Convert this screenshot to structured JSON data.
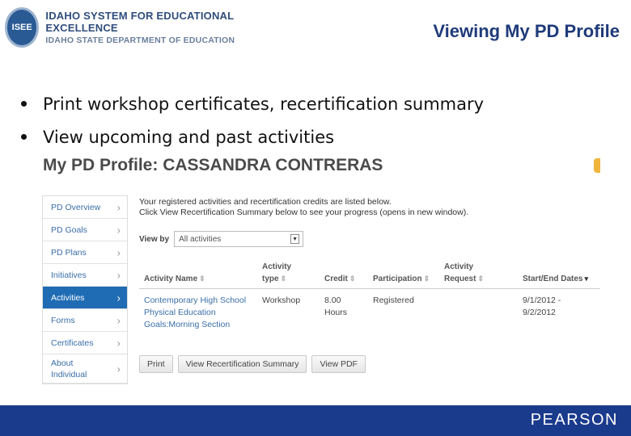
{
  "header": {
    "logo_seal": "ISEE",
    "logo_line1": "IDAHO SYSTEM FOR EDUCATIONAL EXCELLENCE",
    "logo_line2": "IDAHO STATE DEPARTMENT OF EDUCATION",
    "slide_title": "Viewing My PD Profile"
  },
  "bullets": [
    "Print workshop certificates, recertification summary",
    "View upcoming and past activities"
  ],
  "profile": {
    "title_prefix": "My PD Profile:",
    "name": "CASSANDRA CONTRERAS"
  },
  "sidebar": {
    "items": [
      {
        "label": "PD Overview"
      },
      {
        "label": "PD Goals"
      },
      {
        "label": "PD Plans"
      },
      {
        "label": "Initiatives"
      },
      {
        "label": "Activities"
      },
      {
        "label": "Forms"
      },
      {
        "label": "Certificates"
      },
      {
        "label": "About Individual"
      }
    ],
    "active": "Activities",
    "chevron": "›"
  },
  "content": {
    "intro_line1": "Your registered activities and recertification credits are listed below.",
    "intro_line2": "Click View Recertification Summary below to see your progress (opens in new window).",
    "view_by_label": "View by",
    "view_by_value": "All activities",
    "columns": {
      "activity_name": "Activity Name",
      "activity_type": "Activity type",
      "credit": "Credit",
      "participation": "Participation",
      "activity_request": "Activity Request",
      "dates": "Start/End Dates"
    },
    "rows": [
      {
        "activity_name": "Contemporary High School Physical Education Goals:Morning Section",
        "activity_type": "Workshop",
        "credit": "8.00 Hours",
        "participation": "Registered",
        "activity_request": "",
        "dates": "9/1/2012 - 9/2/2012"
      }
    ],
    "buttons": {
      "print": "Print",
      "recert": "View Recertification Summary",
      "pdf": "View PDF"
    }
  },
  "footer": {
    "brand": "PEARSON"
  },
  "colors": {
    "title_blue": "#1f3b7a",
    "active_nav": "#1f6cb4",
    "footer_bar": "#1a3a8c",
    "link_blue": "#3a6ea8"
  }
}
